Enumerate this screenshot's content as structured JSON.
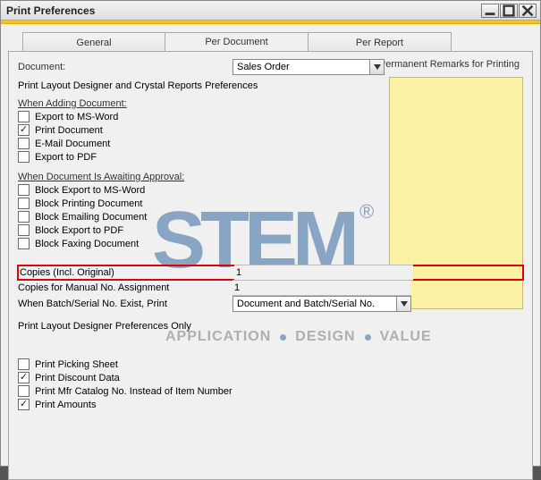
{
  "window": {
    "title": "Print Preferences"
  },
  "tabs": {
    "general": "General",
    "per_document": "Per Document",
    "per_report": "Per Report"
  },
  "doc_row": {
    "label": "Document:",
    "value": "Sales Order"
  },
  "remarks_label": "Permanent Remarks for Printing",
  "section_pref": "Print Layout Designer and Crystal Reports Preferences",
  "section_adding": "When Adding Document:",
  "adding": {
    "export_word": "Export to MS-Word",
    "print_doc": "Print Document",
    "email_doc": "E-Mail Document",
    "export_pdf": "Export to PDF"
  },
  "section_awaiting": "When Document Is Awaiting Approval:",
  "awaiting": {
    "block_word": "Block Export to MS-Word",
    "block_print": "Block Printing Document",
    "block_email": "Block Emailing Document",
    "block_pdf": "Block Export to PDF",
    "block_fax": "Block Faxing Document"
  },
  "copies": {
    "incl_orig_label": "Copies (Incl. Original)",
    "incl_orig_value": "1",
    "manual_label": "Copies for Manual No. Assignment",
    "manual_value": "1",
    "batch_label": "When Batch/Serial No. Exist, Print",
    "batch_value": "Document and Batch/Serial No."
  },
  "section_pldonly": "Print Layout Designer Preferences Only",
  "extras": {
    "picking": "Print Picking Sheet",
    "discount": "Print Discount Data",
    "mfr": "Print Mfr Catalog No. Instead of Item Number",
    "amounts": "Print Amounts"
  },
  "watermark": {
    "main": "STEM",
    "reg": "®",
    "sub_a": "APPLICATION",
    "sub_b": "DESIGN",
    "sub_c": "VALUE"
  }
}
